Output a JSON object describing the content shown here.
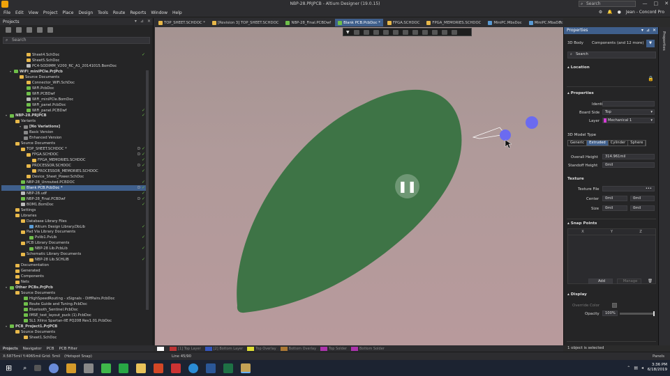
{
  "window": {
    "title": "NBP-28.PRJPCB - Altium Designer (19.0.15)",
    "search_placeholder": "Search"
  },
  "menu": {
    "items": [
      "File",
      "Edit",
      "View",
      "Project",
      "Place",
      "Design",
      "Tools",
      "Route",
      "Reports",
      "Window",
      "Help"
    ],
    "user": "Jean - Concord Pro"
  },
  "projects_panel": {
    "title": "Projects",
    "search_placeholder": "Search",
    "tree": [
      {
        "label": "Sheet4.SchDoc",
        "indent": 30,
        "color": "#e8b84a",
        "chk": "✓"
      },
      {
        "label": "Sheet5.SchDoc",
        "indent": 30,
        "color": "#e8b84a",
        "chk": ""
      },
      {
        "label": "PC4-SODIMM_V200_RC_A1_20141015.BomDoc",
        "indent": 30,
        "color": "#bbbbbb",
        "chk": ""
      },
      {
        "label": "WiFi_miniPCIe.PrjPcb",
        "indent": 12,
        "color": "#6fbf4a",
        "chk": "",
        "bold": true
      },
      {
        "label": "Source Documents",
        "indent": 20,
        "color": "#e8b84a",
        "chk": ""
      },
      {
        "label": "Connector_WiFi.SchDoc",
        "indent": 30,
        "color": "#e8b84a",
        "chk": ""
      },
      {
        "label": "WiFi.PcbDoc",
        "indent": 30,
        "color": "#6fbf4a",
        "chk": ""
      },
      {
        "label": "WiFi.PCBDwf",
        "indent": 30,
        "color": "#6fbf4a",
        "chk": ""
      },
      {
        "label": "WiFi_miniPCIe.BomDoc",
        "indent": 30,
        "color": "#bbbbbb",
        "chk": ""
      },
      {
        "label": "WiFi_panel.PcbDoc",
        "indent": 30,
        "color": "#6fbf4a",
        "chk": ""
      },
      {
        "label": "WiFi_panel.PCBDwf",
        "indent": 30,
        "color": "#6fbf4a",
        "chk": "✓"
      },
      {
        "label": "NBP-28.PRJPCB",
        "indent": 6,
        "color": "#6fbf4a",
        "chk": "✓",
        "bold": true
      },
      {
        "label": "Variants",
        "indent": 14,
        "color": "#e8b84a",
        "chk": ""
      },
      {
        "label": "[No Variations]",
        "indent": 26,
        "color": "#888888",
        "chk": "",
        "bold": true
      },
      {
        "label": "Basic Version",
        "indent": 26,
        "color": "#888888",
        "chk": ""
      },
      {
        "label": "Enhanced Version",
        "indent": 26,
        "color": "#888888",
        "chk": ""
      },
      {
        "label": "Source Documents",
        "indent": 14,
        "color": "#e8b84a",
        "chk": ""
      },
      {
        "label": "TOP_SHEET.SCHDOC *",
        "indent": 22,
        "color": "#e8b84a",
        "chk": "✓",
        "chk2": "D"
      },
      {
        "label": "FPGA.SCHDOC",
        "indent": 30,
        "color": "#e8b84a",
        "chk": "✓",
        "chk2": "D"
      },
      {
        "label": "FPGA_MEMORIES.SCHDOC",
        "indent": 38,
        "color": "#e8b84a",
        "chk": "✓"
      },
      {
        "label": "PROCESSOR.SCHDOC",
        "indent": 30,
        "color": "#e8b84a",
        "chk": "✓",
        "chk2": "D"
      },
      {
        "label": "PROCESSOR_MEMORIES.SCHDOC",
        "indent": 38,
        "color": "#e8b84a",
        "chk": "✓"
      },
      {
        "label": "Device_Sheet_Power.SchDoc",
        "indent": 30,
        "color": "#e8b84a",
        "chk": ""
      },
      {
        "label": "NBP-28_Unrouted.PCBDOC",
        "indent": 22,
        "color": "#6fbf4a",
        "chk": "✓"
      },
      {
        "label": "Blank PCB.PcbDoc *",
        "indent": 22,
        "color": "#6fbf4a",
        "chk": "✓",
        "chk2": "D",
        "sel": true
      },
      {
        "label": "NBP-28.udf",
        "indent": 22,
        "color": "#bbbbbb",
        "chk": "✓"
      },
      {
        "label": "NBP-28_Final.PCBDwf",
        "indent": 22,
        "color": "#6fbf4a",
        "chk": "✓",
        "chk2": "D"
      },
      {
        "label": "BOM1.BomDoc",
        "indent": 22,
        "color": "#bbbbbb",
        "chk": "✓"
      },
      {
        "label": "Settings",
        "indent": 14,
        "color": "#e8b84a",
        "chk": ""
      },
      {
        "label": "Libraries",
        "indent": 14,
        "color": "#e8b84a",
        "chk": ""
      },
      {
        "label": "Database Library Files",
        "indent": 22,
        "color": "#e8b84a",
        "chk": ""
      },
      {
        "label": "Altium Design Library.DbLib",
        "indent": 34,
        "color": "#5a9bd5",
        "chk": "✓"
      },
      {
        "label": "Pad Via Library Documents",
        "indent": 22,
        "color": "#e8b84a",
        "chk": ""
      },
      {
        "label": "Pvlib1.PvLib",
        "indent": 34,
        "color": "#6fbf4a",
        "chk": "✓"
      },
      {
        "label": "PCB Library Documents",
        "indent": 22,
        "color": "#e8b84a",
        "chk": ""
      },
      {
        "label": "NBP-28 Lib.PcbLib",
        "indent": 34,
        "color": "#6fbf4a",
        "chk": "✓"
      },
      {
        "label": "Schematic Library Documents",
        "indent": 22,
        "color": "#e8b84a",
        "chk": ""
      },
      {
        "label": "NBP-28 Lib.SCHLIB",
        "indent": 34,
        "color": "#e8b84a",
        "chk": "✓"
      },
      {
        "label": "Documentation",
        "indent": 14,
        "color": "#e8b84a",
        "chk": ""
      },
      {
        "label": "Generated",
        "indent": 14,
        "color": "#e8b84a",
        "chk": ""
      },
      {
        "label": "Components",
        "indent": 14,
        "color": "#e8b84a",
        "chk": ""
      },
      {
        "label": "Nets",
        "indent": 14,
        "color": "#e8b84a",
        "chk": ""
      },
      {
        "label": "Other PCBs.PrjPcb",
        "indent": 6,
        "color": "#6fbf4a",
        "chk": "",
        "bold": true
      },
      {
        "label": "Source Documents",
        "indent": 14,
        "color": "#e8b84a",
        "chk": ""
      },
      {
        "label": "HighSpeedRouting - xSignals - DiffPairs.PcbDoc",
        "indent": 26,
        "color": "#6fbf4a",
        "chk": ""
      },
      {
        "label": "Route Guide and Tuning.PcbDoc",
        "indent": 26,
        "color": "#6fbf4a",
        "chk": ""
      },
      {
        "label": "Bluetooth_Sentinel.PcbDoc",
        "indent": 26,
        "color": "#6fbf4a",
        "chk": ""
      },
      {
        "label": "IMSE_test_layout_puck (1).PcbDoc",
        "indent": 26,
        "color": "#6fbf4a",
        "chk": ""
      },
      {
        "label": "SL1 Xilinx Spartan-IIE PQ208 Rev1.01.PcbDoc",
        "indent": 26,
        "color": "#6fbf4a",
        "chk": ""
      },
      {
        "label": "PCB_Project1.PrjPCB",
        "indent": 6,
        "color": "#6fbf4a",
        "chk": "",
        "bold": true
      },
      {
        "label": "Source Documents",
        "indent": 14,
        "color": "#e8b84a",
        "chk": ""
      },
      {
        "label": "Sheet1.SchDoc",
        "indent": 26,
        "color": "#e8b84a",
        "chk": ""
      }
    ],
    "bottom_tabs": [
      "Projects",
      "Navigator",
      "PCB",
      "PCB Filter"
    ]
  },
  "doc_tabs": [
    {
      "label": "TOP_SHEET.SCHDOC *",
      "color": "#e8b84a",
      "active": false
    },
    {
      "label": "[Revision 3] TOP_SHEET.SCHDOC",
      "color": "#e8b84a",
      "active": false
    },
    {
      "label": "NBP-28_Final.PCBDwf",
      "color": "#6fbf4a",
      "active": false
    },
    {
      "label": "Blank PCB.PcbDoc *",
      "color": "#6fbf4a",
      "active": true
    },
    {
      "label": "FPGA.SCHDOC",
      "color": "#e8b84a",
      "active": false
    },
    {
      "label": "FPGA_MEMORIES.SCHDOC",
      "color": "#e8b84a",
      "active": false
    },
    {
      "label": "MiniPC.MbsDoc",
      "color": "#5a9bd5",
      "active": false
    },
    {
      "label": "MiniPC.MbaDoc",
      "color": "#5a9bd5",
      "active": false
    }
  ],
  "layer_tabs": [
    {
      "label": "",
      "color": "#ffffff"
    },
    {
      "label": "[1] Top Layer",
      "color": "#bb3333"
    },
    {
      "label": "[2] Bottom Layer",
      "color": "#3355bb"
    },
    {
      "label": "Top Overlay",
      "color": "#dddd33"
    },
    {
      "label": "Bottom Overlay",
      "color": "#aa7733"
    },
    {
      "label": "Top Solder",
      "color": "#aa33aa"
    },
    {
      "label": "Bottom Solder",
      "color": "#aa33aa"
    }
  ],
  "properties": {
    "title": "Properties",
    "entity": "3D Body",
    "filter": "Components (and 12 more)",
    "search_placeholder": "Search",
    "location_label": "Location",
    "properties_label": "Properties",
    "identifier_label": "Identifier",
    "identifier_value": "",
    "board_side_label": "Board Side",
    "board_side_value": "Top",
    "layer_label": "Layer",
    "layer_value": "Mechanical 1",
    "layer_color": "#d43cd4",
    "model_type_label": "3D Model Type",
    "model_types": [
      "Generic",
      "Extruded",
      "Cylinder",
      "Sphere"
    ],
    "model_type_active": "Extruded",
    "overall_height_label": "Overall Height",
    "overall_height_value": "314.961mil",
    "standoff_height_label": "Standoff Height",
    "standoff_height_value": "0mil",
    "texture_label": "Texture",
    "texture_file_label": "Texture File",
    "texture_file_value": "",
    "center_label": "Center",
    "center_x": "0mil",
    "center_y": "0mil",
    "size_label": "Size",
    "size_x": "0mil",
    "size_y": "0mil",
    "snap_points_label": "Snap Points",
    "snap_cols": [
      "X",
      "Y",
      "Z"
    ],
    "add_label": "Add",
    "manage_label": "Manage",
    "display_label": "Display",
    "override_color_label": "Override Color",
    "opacity_label": "Opacity",
    "opacity_value": "100%",
    "status": "1 object is selected",
    "right_strip_label": "Properties"
  },
  "statusbar": {
    "coords": "X:5875mil Y:4065mil",
    "grid": "Grid: 5mil",
    "snap": "(Hotspot Snap)",
    "line": "Line 45/90",
    "panels": "Panels"
  },
  "taskbar": {
    "time": "3:36 PM",
    "date": "6/18/2019"
  },
  "canvas": {
    "shape_color": "#3e7446",
    "handle_color": "#6b6bf0"
  }
}
